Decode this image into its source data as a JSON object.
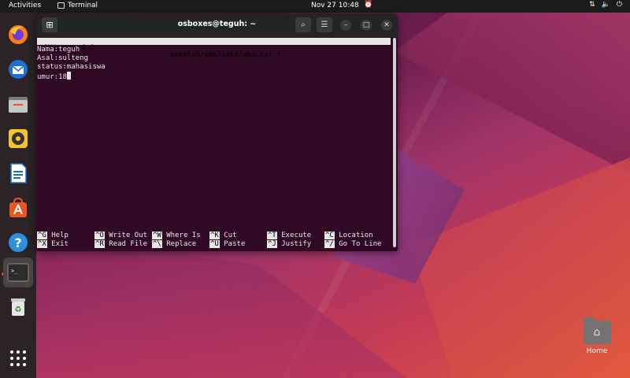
{
  "topbar": {
    "activities": "Activities",
    "app_name": "Terminal",
    "clock": "Nov 27  10:48"
  },
  "dock": {
    "items": [
      {
        "name": "Firefox",
        "icon": "firefox-icon"
      },
      {
        "name": "Thunderbird",
        "icon": "thunderbird-icon"
      },
      {
        "name": "Files",
        "icon": "files-icon"
      },
      {
        "name": "Rhythmbox",
        "icon": "rhythmbox-icon"
      },
      {
        "name": "LibreOffice Writer",
        "icon": "writer-icon"
      },
      {
        "name": "Ubuntu Software",
        "icon": "software-icon"
      },
      {
        "name": "Help",
        "icon": "help-icon"
      },
      {
        "name": "Terminal",
        "icon": "terminal-icon",
        "active": true
      },
      {
        "name": "Trash",
        "icon": "trash-icon"
      },
      {
        "name": "Show Applications",
        "icon": "app-grid-icon"
      }
    ]
  },
  "window": {
    "title": "osboxes@teguh: ~"
  },
  "nano": {
    "version": "GNU nano 6.2",
    "filename": "sekolah/smk/smk4/aku.txt *",
    "lines": [
      "Nama:teguh",
      "Asal:sulteng",
      "status:mahasiswa",
      "umur:18"
    ],
    "shortcuts_row1": [
      {
        "key": "^G",
        "label": "Help"
      },
      {
        "key": "^O",
        "label": "Write Out"
      },
      {
        "key": "^W",
        "label": "Where Is"
      },
      {
        "key": "^K",
        "label": "Cut"
      },
      {
        "key": "^T",
        "label": "Execute"
      },
      {
        "key": "^C",
        "label": "Location"
      }
    ],
    "shortcuts_row2": [
      {
        "key": "^X",
        "label": "Exit"
      },
      {
        "key": "^R",
        "label": "Read File"
      },
      {
        "key": "^\\",
        "label": "Replace"
      },
      {
        "key": "^U",
        "label": "Paste"
      },
      {
        "key": "^J",
        "label": "Justify"
      },
      {
        "key": "^/",
        "label": "Go To Line"
      }
    ]
  },
  "desktop": {
    "home_label": "Home"
  },
  "colors": {
    "terminal_bg": "#300a24",
    "accent": "#e95420"
  }
}
